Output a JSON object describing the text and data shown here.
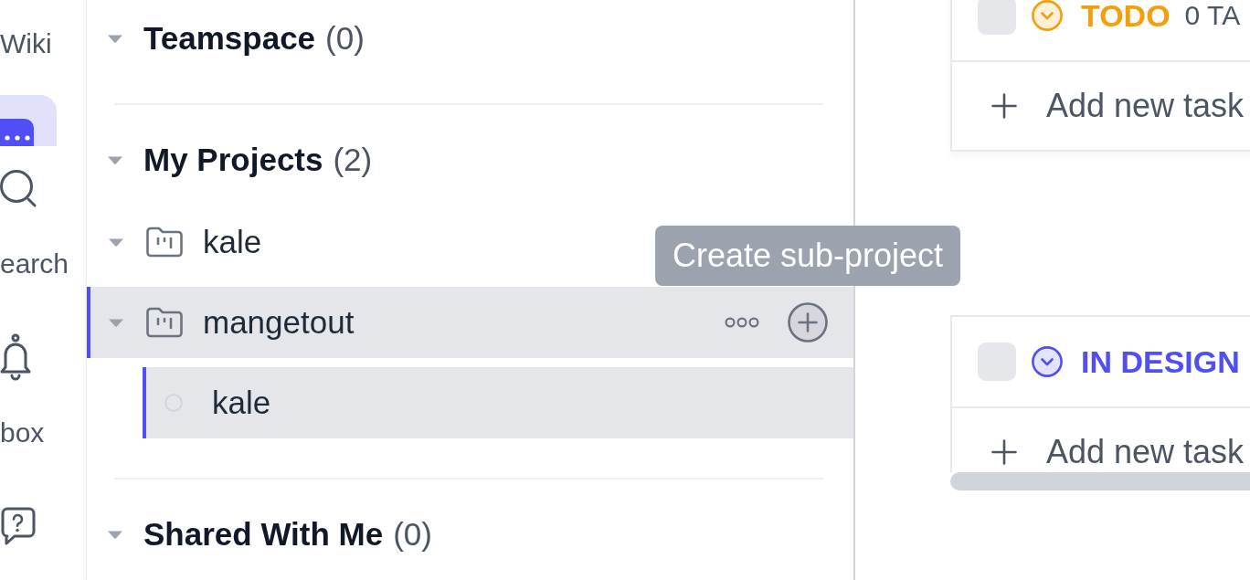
{
  "rail": {
    "items": [
      {
        "kind": "plain",
        "label": "Wiki",
        "selected": false
      },
      {
        "kind": "apps",
        "selected": true
      },
      {
        "kind": "search",
        "label": "earch",
        "selected": false
      },
      {
        "kind": "bell",
        "label": "box",
        "selected": false
      },
      {
        "kind": "help",
        "selected": false
      }
    ]
  },
  "projects": {
    "sections": [
      {
        "title": "Teamspace",
        "count": "(0)",
        "expanded": true
      },
      {
        "title": "My Projects",
        "count": "(2)",
        "expanded": true,
        "items": [
          {
            "name": "kale",
            "expanded": true,
            "selected": false,
            "hovered": false
          },
          {
            "name": "mangetout",
            "expanded": true,
            "selected": true,
            "hovered": true,
            "children": [
              {
                "name": "kale",
                "selected": true
              }
            ]
          }
        ]
      },
      {
        "title": "Shared With Me",
        "count": "(0)",
        "expanded": true
      }
    ]
  },
  "tooltip": {
    "text": "Create sub-project"
  },
  "board": {
    "groups": [
      {
        "title": "TODO",
        "count": "0 TA",
        "color": "#f59e0b",
        "checked": false,
        "add_label": "Add new task"
      },
      {
        "title": "IN DESIGN",
        "color": "#4f4ff5",
        "checked": false,
        "add_label": "Add new task"
      }
    ]
  }
}
